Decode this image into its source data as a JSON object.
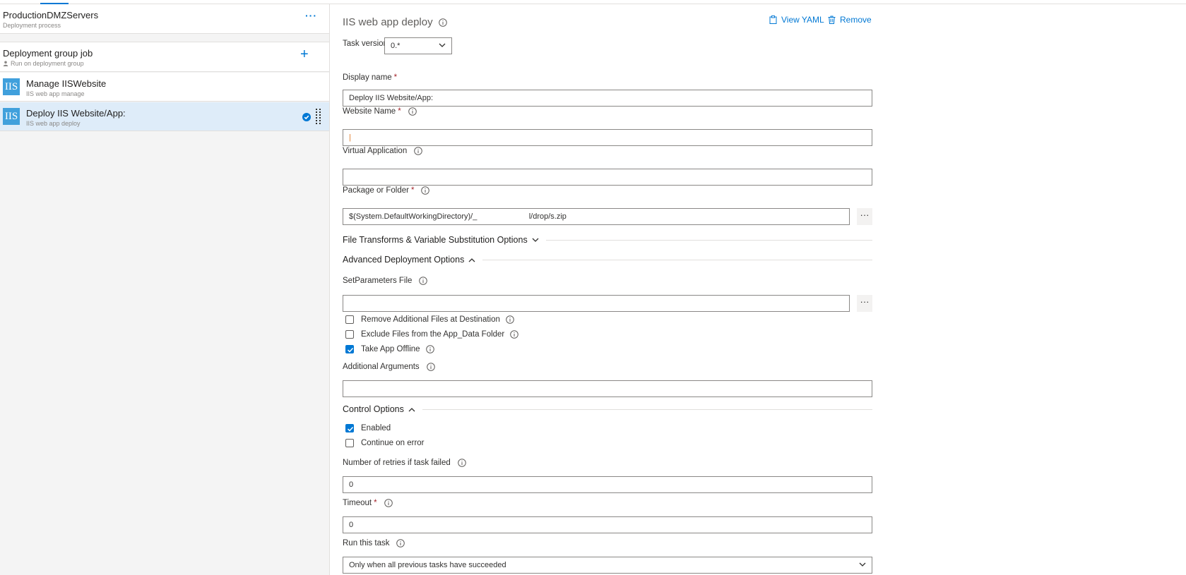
{
  "left": {
    "process": {
      "title": "ProductionDMZServers",
      "subtitle": "Deployment process"
    },
    "job": {
      "title": "Deployment group job",
      "subtitle": "Run on deployment group"
    },
    "tasks": [
      {
        "icon_text": "IIS",
        "name": "Manage IISWebsite",
        "subtitle": "IIS web app manage"
      },
      {
        "icon_text": "IIS",
        "name": "Deploy IIS Website/App:",
        "subtitle": "IIS web app deploy"
      }
    ]
  },
  "right": {
    "title": "IIS web app deploy",
    "view_yaml": "View YAML",
    "remove": "Remove",
    "task_version": {
      "label": "Task version",
      "value": "0.*"
    },
    "display_name": {
      "label": "Display name",
      "value": "Deploy IIS Website/App:"
    },
    "website_name": {
      "label": "Website Name",
      "value": "|"
    },
    "virtual_application": {
      "label": "Virtual Application",
      "value": ""
    },
    "package_or_folder": {
      "label": "Package or Folder",
      "value": "$(System.DefaultWorkingDirectory)/_                        l/drop/s.zip"
    },
    "file_transforms_section": "File Transforms & Variable Substitution Options",
    "advanced_section": "Advanced Deployment Options",
    "set_parameters_file": {
      "label": "SetParameters File",
      "value": ""
    },
    "remove_additional_files": {
      "label": "Remove Additional Files at Destination",
      "checked": false
    },
    "exclude_app_data": {
      "label": "Exclude Files from the App_Data Folder",
      "checked": false
    },
    "take_app_offline": {
      "label": "Take App Offline",
      "checked": true
    },
    "additional_arguments": {
      "label": "Additional Arguments",
      "value": ""
    },
    "control_section": "Control Options",
    "enabled": {
      "label": "Enabled",
      "checked": true
    },
    "continue_on_error": {
      "label": "Continue on error",
      "checked": false
    },
    "retries": {
      "label": "Number of retries if task failed",
      "value": "0"
    },
    "timeout": {
      "label": "Timeout",
      "value": "0"
    },
    "run_this_task": {
      "label": "Run this task",
      "value": "Only when all previous tasks have succeeded"
    },
    "required_marker": "*",
    "ellipsis": "···"
  },
  "colors": {
    "accent": "#0078d4",
    "selected_row": "#deecf9",
    "iis_icon": "#40a0dc",
    "required": "#a4262c"
  }
}
